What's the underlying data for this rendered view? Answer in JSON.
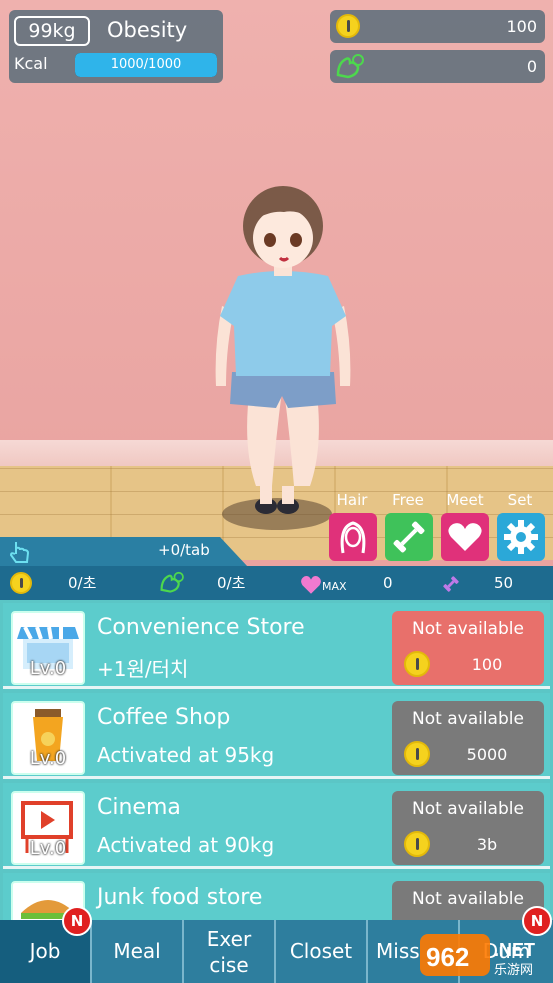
{
  "hud": {
    "weight": "99kg",
    "status": "Obesity",
    "kcal_label": "Kcal",
    "kcal_value": "1000/1000",
    "kcal_fraction": 1.0,
    "coins": "100",
    "muscle": "0"
  },
  "actions": [
    {
      "label": "Hair",
      "icon": "hair-icon",
      "color": "#e0317a"
    },
    {
      "label": "Free",
      "icon": "dumbbell-icon",
      "color": "#3fc25a"
    },
    {
      "label": "Meet",
      "icon": "heart-icon",
      "color": "#e0317a"
    },
    {
      "label": "Set",
      "icon": "gear-icon",
      "color": "#2ba8d8"
    }
  ],
  "tap": {
    "per_tap": "+0/tab"
  },
  "stats": {
    "coin_rate": "0/초",
    "muscle_rate": "0/초",
    "heart_max": "MAX",
    "heart_value": "0",
    "dumbbell_value": "50"
  },
  "jobs": [
    {
      "name": "Convenience Store",
      "desc": "+1원/터치",
      "level": "Lv.0",
      "button": "Not available",
      "cost": "100",
      "available_style": "red",
      "icon": "store-icon"
    },
    {
      "name": "Coffee Shop",
      "desc": "Activated at 95kg",
      "level": "Lv.0",
      "button": "Not available",
      "cost": "5000",
      "available_style": "gray",
      "icon": "coffee-icon"
    },
    {
      "name": "Cinema",
      "desc": "Activated at 90kg",
      "level": "Lv.0",
      "button": "Not available",
      "cost": "3b",
      "available_style": "gray",
      "icon": "cinema-icon"
    },
    {
      "name": "Junk food store",
      "desc": "",
      "level": "",
      "button": "Not available",
      "cost": "",
      "available_style": "gray",
      "icon": "burger-icon"
    }
  ],
  "tabs": [
    {
      "line1": "Job",
      "line2": "",
      "active": true,
      "badge": "N"
    },
    {
      "line1": "Meal",
      "line2": "",
      "active": false,
      "badge": ""
    },
    {
      "line1": "Exer",
      "line2": "cise",
      "active": false,
      "badge": ""
    },
    {
      "line1": "Closet",
      "line2": "",
      "active": false,
      "badge": ""
    },
    {
      "line1": "Miss",
      "line2": "",
      "active": false,
      "badge": ""
    },
    {
      "line1": "Dum",
      "line2": "",
      "active": false,
      "badge": "N"
    }
  ],
  "watermark": "962.NET 乐游网"
}
